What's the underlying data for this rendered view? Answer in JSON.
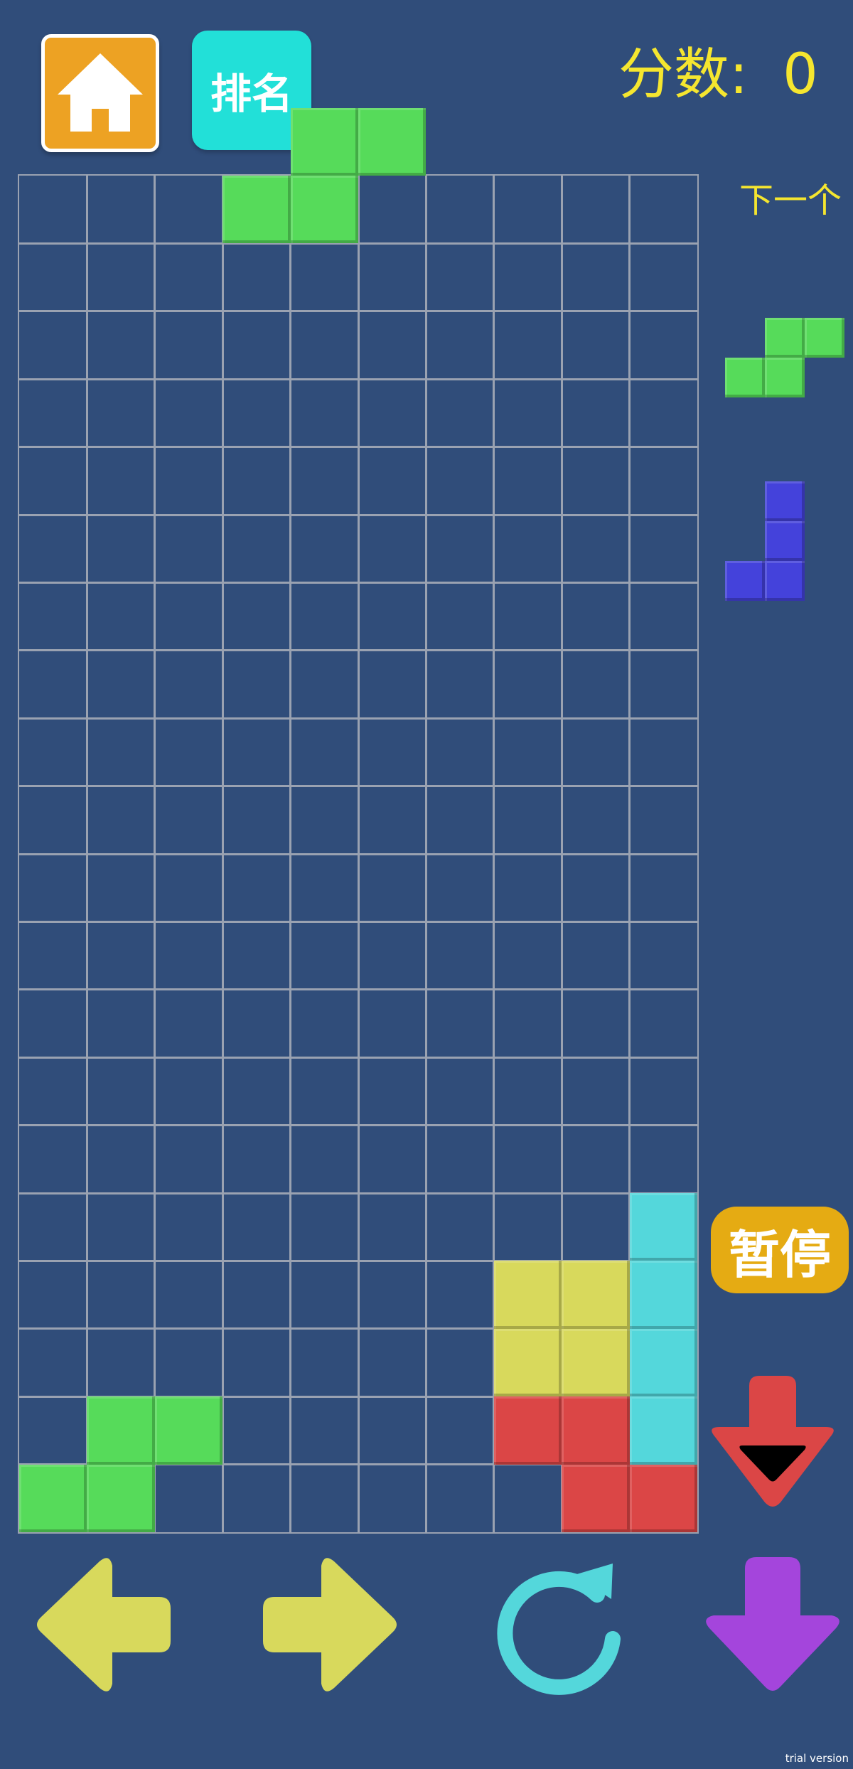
{
  "header": {
    "home_icon": "house-icon",
    "rank_label": "排名",
    "score_label": "分数:",
    "score_value": "0"
  },
  "side": {
    "next_label": "下一个",
    "pause_label": "暂停"
  },
  "watermark": "trial version",
  "colors": {
    "background": "#304d7a",
    "grid_line": "#9aa2b1",
    "green": "#56db5a",
    "yellow": "#d8d95c",
    "cyan": "#54d7db",
    "red": "#db4646",
    "blue": "#4442db",
    "purple": "#a445dc",
    "accent_text": "#f5e62f"
  },
  "board": {
    "columns": 10,
    "rows": 20,
    "falling_piece": {
      "shape": "S",
      "color": "green",
      "cells": [
        [
          4,
          -1
        ],
        [
          5,
          -1
        ],
        [
          3,
          0
        ],
        [
          4,
          0
        ]
      ]
    },
    "placed_cells": [
      {
        "col": 9,
        "row": 15,
        "color": "cyan"
      },
      {
        "col": 9,
        "row": 16,
        "color": "cyan"
      },
      {
        "col": 9,
        "row": 17,
        "color": "cyan"
      },
      {
        "col": 9,
        "row": 18,
        "color": "cyan"
      },
      {
        "col": 7,
        "row": 16,
        "color": "yellow"
      },
      {
        "col": 8,
        "row": 16,
        "color": "yellow"
      },
      {
        "col": 7,
        "row": 17,
        "color": "yellow"
      },
      {
        "col": 8,
        "row": 17,
        "color": "yellow"
      },
      {
        "col": 7,
        "row": 18,
        "color": "red"
      },
      {
        "col": 8,
        "row": 18,
        "color": "red"
      },
      {
        "col": 8,
        "row": 19,
        "color": "red"
      },
      {
        "col": 9,
        "row": 19,
        "color": "red"
      },
      {
        "col": 1,
        "row": 18,
        "color": "green"
      },
      {
        "col": 2,
        "row": 18,
        "color": "green"
      },
      {
        "col": 0,
        "row": 19,
        "color": "green"
      },
      {
        "col": 1,
        "row": 19,
        "color": "green"
      }
    ]
  },
  "next_pieces": [
    {
      "shape": "S",
      "color": "green",
      "cells": [
        [
          1,
          0
        ],
        [
          2,
          0
        ],
        [
          0,
          1
        ],
        [
          1,
          1
        ]
      ]
    },
    {
      "shape": "J",
      "color": "blue",
      "cells": [
        [
          1,
          0
        ],
        [
          1,
          1
        ],
        [
          0,
          2
        ],
        [
          1,
          2
        ]
      ]
    }
  ],
  "controls": [
    {
      "name": "move-left-button",
      "icon": "arrow-left-icon",
      "color": "yellow"
    },
    {
      "name": "move-right-button",
      "icon": "arrow-right-icon",
      "color": "yellow"
    },
    {
      "name": "rotate-button",
      "icon": "rotate-icon",
      "color": "cyan"
    },
    {
      "name": "soft-drop-button",
      "icon": "arrow-down-icon",
      "color": "purple"
    },
    {
      "name": "hard-drop-button",
      "icon": "hard-drop-arrow-icon",
      "color": "red"
    }
  ]
}
